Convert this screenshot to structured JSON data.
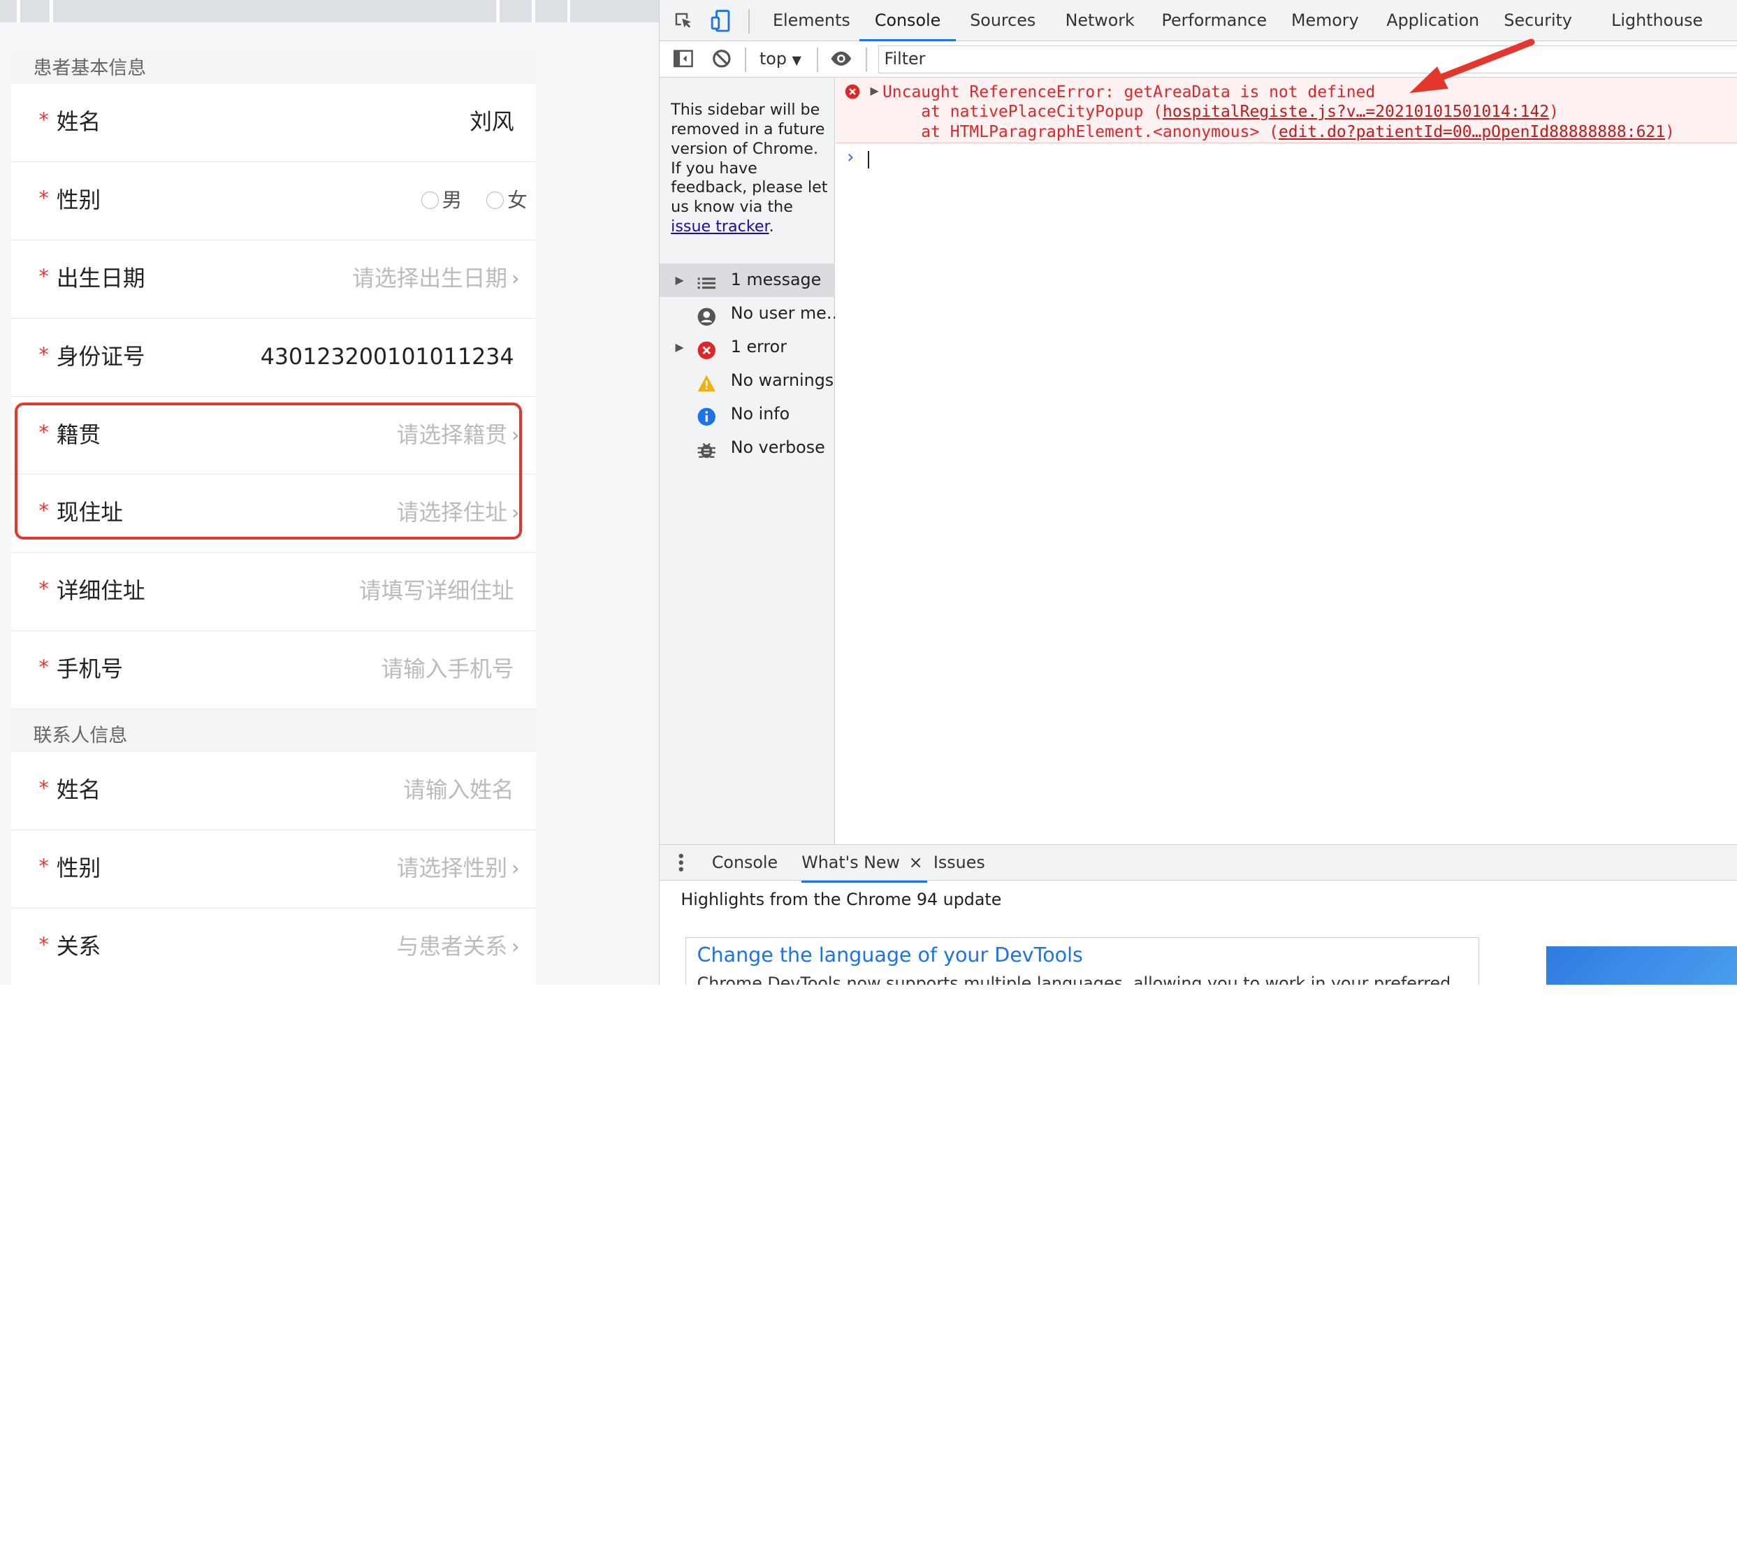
{
  "form": {
    "section_patient": "患者基本信息",
    "section_contact": "联系人信息",
    "rows": [
      {
        "label": "姓名",
        "value": "刘风",
        "kind": "value"
      },
      {
        "label": "性别",
        "kind": "radio",
        "options": [
          "男",
          "女"
        ]
      },
      {
        "label": "出生日期",
        "placeholder": "请选择出生日期",
        "kind": "select"
      },
      {
        "label": "身份证号",
        "value": "430123200101011234",
        "kind": "value"
      },
      {
        "label": "籍贯",
        "placeholder": "请选择籍贯",
        "kind": "select"
      },
      {
        "label": "现住址",
        "placeholder": "请选择住址",
        "kind": "select"
      },
      {
        "label": "详细住址",
        "placeholder": "请填写详细住址",
        "kind": "input"
      },
      {
        "label": "手机号",
        "placeholder": "请输入手机号",
        "kind": "input"
      }
    ],
    "contact_rows": [
      {
        "label": "姓名",
        "placeholder": "请输入姓名",
        "kind": "input"
      },
      {
        "label": "性别",
        "placeholder": "请选择性别",
        "kind": "select"
      },
      {
        "label": "关系",
        "placeholder": "与患者关系",
        "kind": "select"
      }
    ],
    "required_mark": "*",
    "chevron": "›"
  },
  "devtools": {
    "tabs": [
      "Elements",
      "Console",
      "Sources",
      "Network",
      "Performance",
      "Memory",
      "Application",
      "Security",
      "Lighthouse"
    ],
    "active_tab": "Console",
    "context": "top",
    "filter_placeholder": "Filter",
    "sidebar_note_pre": "This sidebar will be removed in a future version of Chrome. If you have feedback, please let us know via the",
    "sidebar_note_link": "issue tracker",
    "sidebar_note_post": ".",
    "sidebar_items": [
      {
        "text": "1 message",
        "icon": "list-icon",
        "expandable": true
      },
      {
        "text": "No user me…",
        "icon": "user-icon",
        "expandable": false
      },
      {
        "text": "1 error",
        "icon": "error-icon",
        "expandable": true
      },
      {
        "text": "No warnings",
        "icon": "warning-icon",
        "expandable": false
      },
      {
        "text": "No info",
        "icon": "info-icon",
        "expandable": false
      },
      {
        "text": "No verbose",
        "icon": "bug-icon",
        "expandable": false
      }
    ],
    "error": {
      "message": "Uncaught ReferenceError: getAreaData is not defined",
      "line1_prefix": "    at nativePlaceCityPopup (",
      "line1_link": "hospitalRegiste.js?v…=20210101501014:142",
      "line1_suffix": ")",
      "line2_prefix": "    at HTMLParagraphElement.<anonymous> (",
      "line2_link": "edit.do?patientId=00…pOpenId88888888:621",
      "line2_suffix": ")"
    },
    "prompt_symbol": "›",
    "drawer_tabs": [
      "Console",
      "What's New",
      "Issues"
    ],
    "drawer_active": "What's New",
    "drawer_close": "×",
    "highlights": "Highlights from the Chrome 94 update",
    "card_title": "Change the language of your DevTools",
    "card_desc": "Chrome DevTools now supports multiple languages, allowing you to work in your preferred",
    "colors": {
      "error": "#e02626",
      "accent": "#1a73e8",
      "highlight_box": "#e03a2e"
    }
  }
}
